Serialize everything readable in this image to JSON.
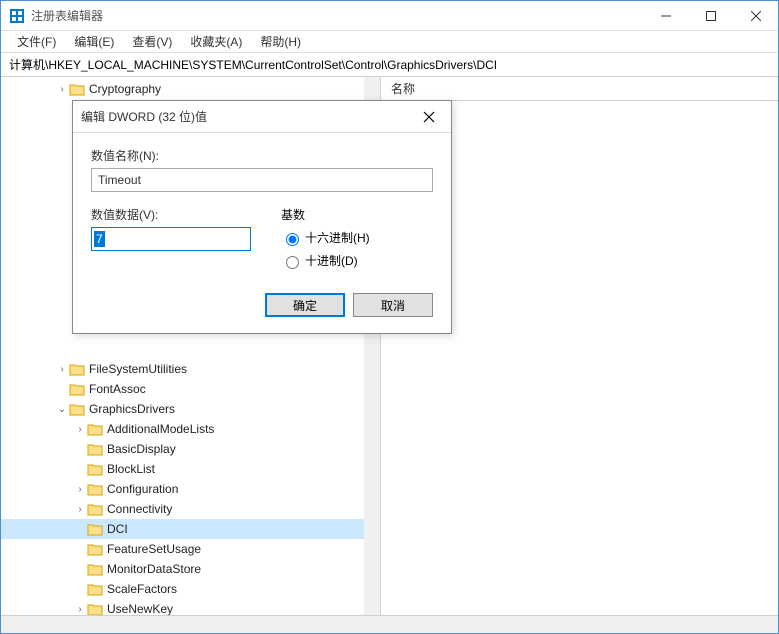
{
  "window": {
    "title": "注册表编辑器"
  },
  "menu": {
    "file": "文件(F)",
    "edit": "编辑(E)",
    "view": "查看(V)",
    "favorites": "收藏夹(A)",
    "help": "帮助(H)"
  },
  "address": "计算机\\HKEY_LOCAL_MACHINE\\SYSTEM\\CurrentControlSet\\Control\\GraphicsDrivers\\DCI",
  "list": {
    "col_name": "名称"
  },
  "tree": {
    "items": [
      {
        "indent": 3,
        "expander": ">",
        "label": "Cryptography"
      },
      {
        "indent": 3,
        "expander": ">",
        "label": "FileSystemUtilities"
      },
      {
        "indent": 3,
        "expander": "",
        "label": "FontAssoc"
      },
      {
        "indent": 3,
        "expander": "v",
        "label": "GraphicsDrivers"
      },
      {
        "indent": 4,
        "expander": ">",
        "label": "AdditionalModeLists"
      },
      {
        "indent": 4,
        "expander": "",
        "label": "BasicDisplay"
      },
      {
        "indent": 4,
        "expander": "",
        "label": "BlockList"
      },
      {
        "indent": 4,
        "expander": ">",
        "label": "Configuration"
      },
      {
        "indent": 4,
        "expander": ">",
        "label": "Connectivity"
      },
      {
        "indent": 4,
        "expander": "",
        "label": "DCI",
        "selected": true
      },
      {
        "indent": 4,
        "expander": "",
        "label": "FeatureSetUsage"
      },
      {
        "indent": 4,
        "expander": "",
        "label": "MonitorDataStore"
      },
      {
        "indent": 4,
        "expander": "",
        "label": "ScaleFactors"
      },
      {
        "indent": 4,
        "expander": ">",
        "label": "UseNewKey"
      }
    ]
  },
  "dialog": {
    "title": "编辑 DWORD (32 位)值",
    "name_label": "数值名称(N):",
    "name_value": "Timeout",
    "data_label": "数值数据(V):",
    "data_value": "7",
    "base_label": "基数",
    "radio_hex": "十六进制(H)",
    "radio_dec": "十进制(D)",
    "ok": "确定",
    "cancel": "取消"
  }
}
